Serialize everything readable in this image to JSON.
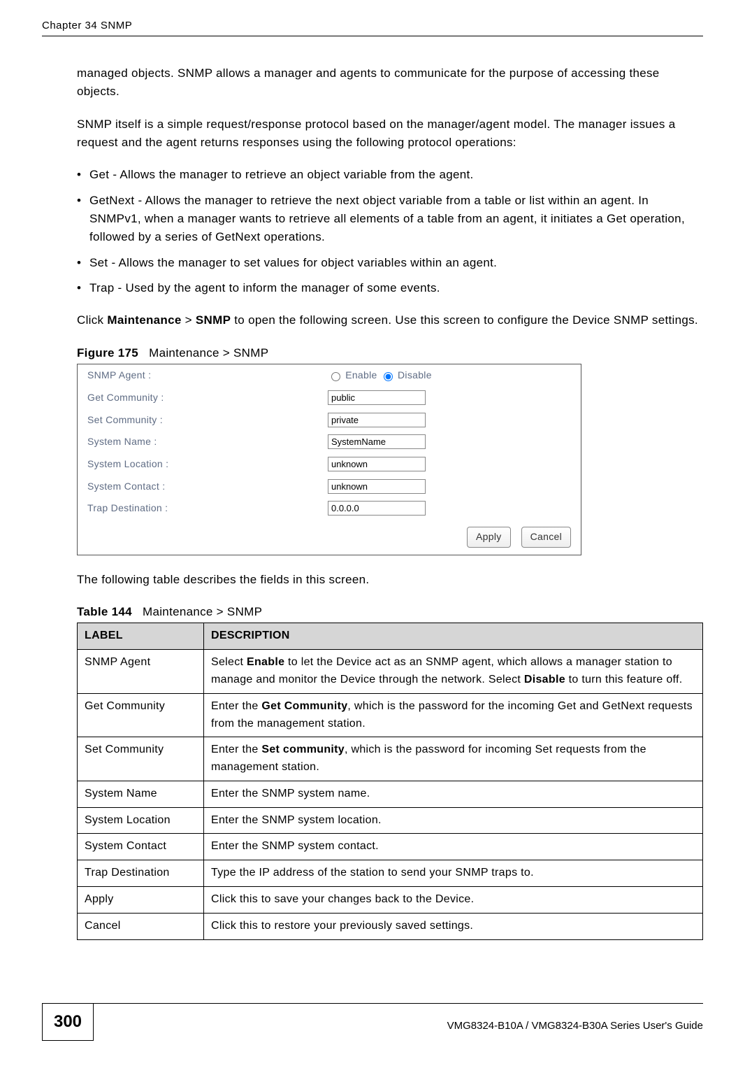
{
  "header": {
    "chapter": "Chapter 34 SNMP"
  },
  "paras": {
    "p1": "managed objects. SNMP allows a manager and agents to communicate for the purpose of accessing these objects.",
    "p2": "SNMP itself is a simple request/response protocol based on the manager/agent model. The manager issues a request and the agent returns responses using the following protocol operations:"
  },
  "bullets": [
    "Get - Allows the manager to retrieve an object variable from the agent.",
    "GetNext - Allows the manager to retrieve the next object variable from a table or list within an agent. In SNMPv1, when a manager wants to retrieve all elements of a table from an agent, it initiates a Get operation, followed by a series of GetNext operations.",
    "Set - Allows the manager to set values for object variables within an agent.",
    "Trap - Used by the agent to inform the manager of some events."
  ],
  "click_para": {
    "pre": "Click ",
    "b1": "Maintenance",
    "mid": " > ",
    "b2": "SNMP",
    "post": " to open the following screen. Use this screen to configure the Device SNMP settings."
  },
  "figure": {
    "num": "Figure 175",
    "title": "Maintenance > SNMP"
  },
  "form": {
    "rows": [
      {
        "label": "SNMP Agent :",
        "type": "radio",
        "opt1": "Enable",
        "opt2": "Disable"
      },
      {
        "label": "Get Community :",
        "type": "text",
        "value": "public"
      },
      {
        "label": "Set Community :",
        "type": "text",
        "value": "private"
      },
      {
        "label": "System Name :",
        "type": "text",
        "value": "SystemName"
      },
      {
        "label": "System Location :",
        "type": "text",
        "value": "unknown"
      },
      {
        "label": "System Contact :",
        "type": "text",
        "value": "unknown"
      },
      {
        "label": "Trap Destination :",
        "type": "text",
        "value": "0.0.0.0"
      }
    ],
    "apply": "Apply",
    "cancel": "Cancel"
  },
  "table_intro": "The following table describes the fields in this screen.",
  "table_caption": {
    "num": "Table 144",
    "title": "Maintenance > SNMP"
  },
  "table": {
    "head": {
      "c1": "LABEL",
      "c2": "DESCRIPTION"
    },
    "rows": [
      {
        "label": "SNMP Agent",
        "desc_pre": "Select ",
        "desc_b1": "Enable",
        "desc_mid": " to let the Device act as an SNMP agent, which allows a manager station to manage and monitor the Device through the network. Select ",
        "desc_b2": "Disable",
        "desc_post": " to turn this feature off."
      },
      {
        "label": "Get Community",
        "desc_pre": "Enter the ",
        "desc_b1": "Get Community",
        "desc_mid": "",
        "desc_b2": "",
        "desc_post": ", which is the password for the incoming Get and GetNext requests from the management station."
      },
      {
        "label": "Set Community",
        "desc_pre": "Enter the ",
        "desc_b1": "Set community",
        "desc_mid": "",
        "desc_b2": "",
        "desc_post": ", which is the password for incoming Set requests from the management station."
      },
      {
        "label": "System Name",
        "desc_pre": "Enter the SNMP system name.",
        "desc_b1": "",
        "desc_mid": "",
        "desc_b2": "",
        "desc_post": ""
      },
      {
        "label": "System Location",
        "desc_pre": "Enter the SNMP system location.",
        "desc_b1": "",
        "desc_mid": "",
        "desc_b2": "",
        "desc_post": ""
      },
      {
        "label": "System Contact",
        "desc_pre": "Enter the SNMP system contact.",
        "desc_b1": "",
        "desc_mid": "",
        "desc_b2": "",
        "desc_post": ""
      },
      {
        "label": "Trap Destination",
        "desc_pre": "Type the IP address of the station to send your SNMP traps to.",
        "desc_b1": "",
        "desc_mid": "",
        "desc_b2": "",
        "desc_post": ""
      },
      {
        "label": "Apply",
        "desc_pre": "Click this to save your changes back to the Device.",
        "desc_b1": "",
        "desc_mid": "",
        "desc_b2": "",
        "desc_post": ""
      },
      {
        "label": "Cancel",
        "desc_pre": "Click this to restore your previously saved settings.",
        "desc_b1": "",
        "desc_mid": "",
        "desc_b2": "",
        "desc_post": ""
      }
    ]
  },
  "footer": {
    "page": "300",
    "guide": "VMG8324-B10A / VMG8324-B30A Series User's Guide"
  }
}
